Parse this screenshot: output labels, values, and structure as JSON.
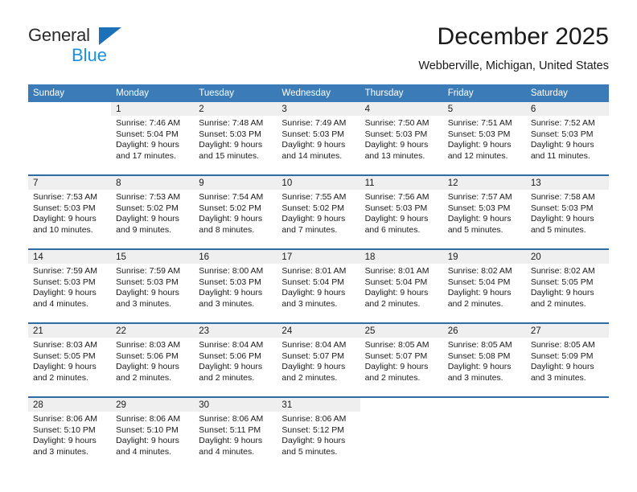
{
  "logo": {
    "word_top": "General",
    "word_bottom": "Blue",
    "triangle_color": "#1d71b8",
    "blue_text_color": "#1d8fe0"
  },
  "header": {
    "title": "December 2025",
    "subtitle": "Webberville, Michigan, United States"
  },
  "theme": {
    "header_row_bg": "#3b7cb8",
    "row_divider": "#2e6da4",
    "daynum_band_bg": "#efefef",
    "text_color": "#1a1a1a"
  },
  "weekday_headers": [
    "Sunday",
    "Monday",
    "Tuesday",
    "Wednesday",
    "Thursday",
    "Friday",
    "Saturday"
  ],
  "weeks": [
    [
      {
        "day": "",
        "sunrise": "",
        "sunset": "",
        "daylight1": "",
        "daylight2": "",
        "empty": true
      },
      {
        "day": "1",
        "sunrise": "Sunrise: 7:46 AM",
        "sunset": "Sunset: 5:04 PM",
        "daylight1": "Daylight: 9 hours",
        "daylight2": "and 17 minutes."
      },
      {
        "day": "2",
        "sunrise": "Sunrise: 7:48 AM",
        "sunset": "Sunset: 5:03 PM",
        "daylight1": "Daylight: 9 hours",
        "daylight2": "and 15 minutes."
      },
      {
        "day": "3",
        "sunrise": "Sunrise: 7:49 AM",
        "sunset": "Sunset: 5:03 PM",
        "daylight1": "Daylight: 9 hours",
        "daylight2": "and 14 minutes."
      },
      {
        "day": "4",
        "sunrise": "Sunrise: 7:50 AM",
        "sunset": "Sunset: 5:03 PM",
        "daylight1": "Daylight: 9 hours",
        "daylight2": "and 13 minutes."
      },
      {
        "day": "5",
        "sunrise": "Sunrise: 7:51 AM",
        "sunset": "Sunset: 5:03 PM",
        "daylight1": "Daylight: 9 hours",
        "daylight2": "and 12 minutes."
      },
      {
        "day": "6",
        "sunrise": "Sunrise: 7:52 AM",
        "sunset": "Sunset: 5:03 PM",
        "daylight1": "Daylight: 9 hours",
        "daylight2": "and 11 minutes."
      }
    ],
    [
      {
        "day": "7",
        "sunrise": "Sunrise: 7:53 AM",
        "sunset": "Sunset: 5:03 PM",
        "daylight1": "Daylight: 9 hours",
        "daylight2": "and 10 minutes."
      },
      {
        "day": "8",
        "sunrise": "Sunrise: 7:53 AM",
        "sunset": "Sunset: 5:02 PM",
        "daylight1": "Daylight: 9 hours",
        "daylight2": "and 9 minutes."
      },
      {
        "day": "9",
        "sunrise": "Sunrise: 7:54 AM",
        "sunset": "Sunset: 5:02 PM",
        "daylight1": "Daylight: 9 hours",
        "daylight2": "and 8 minutes."
      },
      {
        "day": "10",
        "sunrise": "Sunrise: 7:55 AM",
        "sunset": "Sunset: 5:02 PM",
        "daylight1": "Daylight: 9 hours",
        "daylight2": "and 7 minutes."
      },
      {
        "day": "11",
        "sunrise": "Sunrise: 7:56 AM",
        "sunset": "Sunset: 5:03 PM",
        "daylight1": "Daylight: 9 hours",
        "daylight2": "and 6 minutes."
      },
      {
        "day": "12",
        "sunrise": "Sunrise: 7:57 AM",
        "sunset": "Sunset: 5:03 PM",
        "daylight1": "Daylight: 9 hours",
        "daylight2": "and 5 minutes."
      },
      {
        "day": "13",
        "sunrise": "Sunrise: 7:58 AM",
        "sunset": "Sunset: 5:03 PM",
        "daylight1": "Daylight: 9 hours",
        "daylight2": "and 5 minutes."
      }
    ],
    [
      {
        "day": "14",
        "sunrise": "Sunrise: 7:59 AM",
        "sunset": "Sunset: 5:03 PM",
        "daylight1": "Daylight: 9 hours",
        "daylight2": "and 4 minutes."
      },
      {
        "day": "15",
        "sunrise": "Sunrise: 7:59 AM",
        "sunset": "Sunset: 5:03 PM",
        "daylight1": "Daylight: 9 hours",
        "daylight2": "and 3 minutes."
      },
      {
        "day": "16",
        "sunrise": "Sunrise: 8:00 AM",
        "sunset": "Sunset: 5:03 PM",
        "daylight1": "Daylight: 9 hours",
        "daylight2": "and 3 minutes."
      },
      {
        "day": "17",
        "sunrise": "Sunrise: 8:01 AM",
        "sunset": "Sunset: 5:04 PM",
        "daylight1": "Daylight: 9 hours",
        "daylight2": "and 3 minutes."
      },
      {
        "day": "18",
        "sunrise": "Sunrise: 8:01 AM",
        "sunset": "Sunset: 5:04 PM",
        "daylight1": "Daylight: 9 hours",
        "daylight2": "and 2 minutes."
      },
      {
        "day": "19",
        "sunrise": "Sunrise: 8:02 AM",
        "sunset": "Sunset: 5:04 PM",
        "daylight1": "Daylight: 9 hours",
        "daylight2": "and 2 minutes."
      },
      {
        "day": "20",
        "sunrise": "Sunrise: 8:02 AM",
        "sunset": "Sunset: 5:05 PM",
        "daylight1": "Daylight: 9 hours",
        "daylight2": "and 2 minutes."
      }
    ],
    [
      {
        "day": "21",
        "sunrise": "Sunrise: 8:03 AM",
        "sunset": "Sunset: 5:05 PM",
        "daylight1": "Daylight: 9 hours",
        "daylight2": "and 2 minutes."
      },
      {
        "day": "22",
        "sunrise": "Sunrise: 8:03 AM",
        "sunset": "Sunset: 5:06 PM",
        "daylight1": "Daylight: 9 hours",
        "daylight2": "and 2 minutes."
      },
      {
        "day": "23",
        "sunrise": "Sunrise: 8:04 AM",
        "sunset": "Sunset: 5:06 PM",
        "daylight1": "Daylight: 9 hours",
        "daylight2": "and 2 minutes."
      },
      {
        "day": "24",
        "sunrise": "Sunrise: 8:04 AM",
        "sunset": "Sunset: 5:07 PM",
        "daylight1": "Daylight: 9 hours",
        "daylight2": "and 2 minutes."
      },
      {
        "day": "25",
        "sunrise": "Sunrise: 8:05 AM",
        "sunset": "Sunset: 5:07 PM",
        "daylight1": "Daylight: 9 hours",
        "daylight2": "and 2 minutes."
      },
      {
        "day": "26",
        "sunrise": "Sunrise: 8:05 AM",
        "sunset": "Sunset: 5:08 PM",
        "daylight1": "Daylight: 9 hours",
        "daylight2": "and 3 minutes."
      },
      {
        "day": "27",
        "sunrise": "Sunrise: 8:05 AM",
        "sunset": "Sunset: 5:09 PM",
        "daylight1": "Daylight: 9 hours",
        "daylight2": "and 3 minutes."
      }
    ],
    [
      {
        "day": "28",
        "sunrise": "Sunrise: 8:06 AM",
        "sunset": "Sunset: 5:10 PM",
        "daylight1": "Daylight: 9 hours",
        "daylight2": "and 3 minutes."
      },
      {
        "day": "29",
        "sunrise": "Sunrise: 8:06 AM",
        "sunset": "Sunset: 5:10 PM",
        "daylight1": "Daylight: 9 hours",
        "daylight2": "and 4 minutes."
      },
      {
        "day": "30",
        "sunrise": "Sunrise: 8:06 AM",
        "sunset": "Sunset: 5:11 PM",
        "daylight1": "Daylight: 9 hours",
        "daylight2": "and 4 minutes."
      },
      {
        "day": "31",
        "sunrise": "Sunrise: 8:06 AM",
        "sunset": "Sunset: 5:12 PM",
        "daylight1": "Daylight: 9 hours",
        "daylight2": "and 5 minutes."
      },
      {
        "day": "",
        "sunrise": "",
        "sunset": "",
        "daylight1": "",
        "daylight2": "",
        "empty": true
      },
      {
        "day": "",
        "sunrise": "",
        "sunset": "",
        "daylight1": "",
        "daylight2": "",
        "empty": true
      },
      {
        "day": "",
        "sunrise": "",
        "sunset": "",
        "daylight1": "",
        "daylight2": "",
        "empty": true
      }
    ]
  ]
}
